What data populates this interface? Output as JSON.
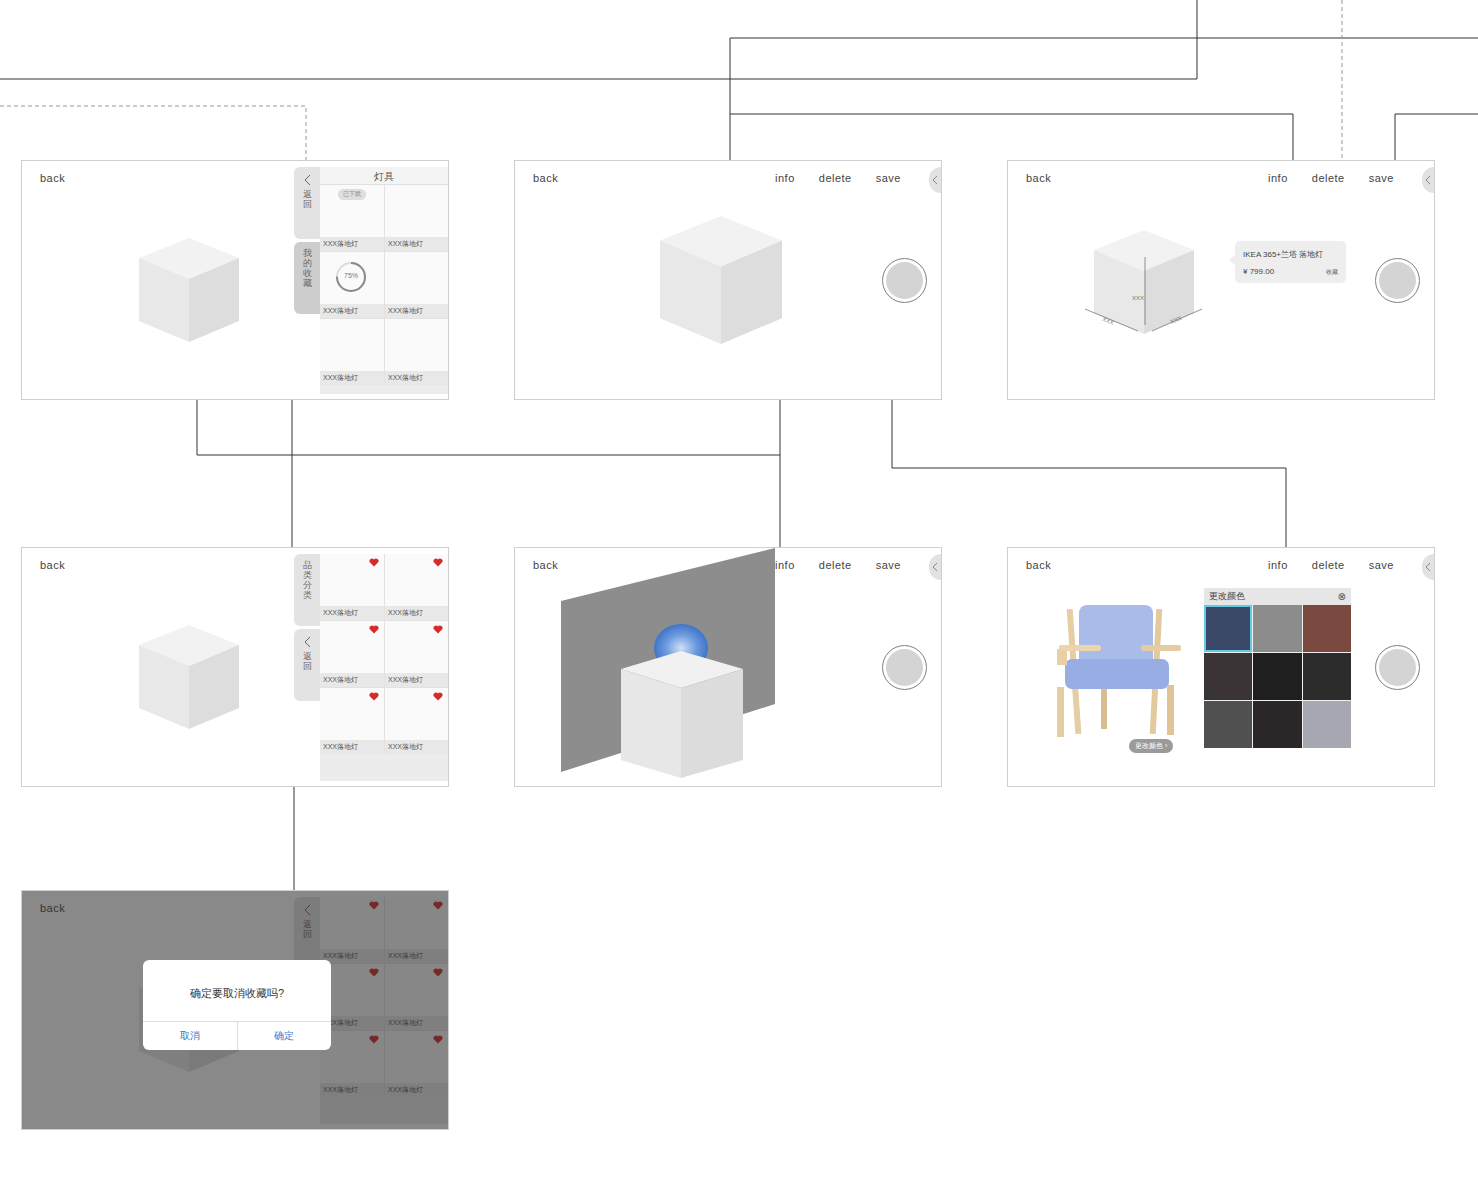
{
  "screens": [
    {
      "kind": "catalog",
      "back": "back",
      "title": "灯具",
      "tabs": [
        {
          "label": "返回",
          "kind": "back",
          "selected": false
        },
        {
          "label": "我的收藏",
          "kind": "plain",
          "selected": true
        }
      ],
      "items": [
        {
          "label": "XXX落地灯",
          "kind": "downloaded",
          "badge": "已下载"
        },
        {
          "label": "XXX落地灯",
          "kind": "plain"
        },
        {
          "label": "XXX落地灯",
          "kind": "downloading",
          "progress": "75%",
          "level": 0.75
        },
        {
          "label": "XXX落地灯",
          "kind": "plain"
        },
        {
          "label": "XXX落地灯",
          "kind": "plain"
        },
        {
          "label": "XXX落地灯",
          "kind": "plain"
        }
      ]
    },
    {
      "kind": "editor",
      "back": "back",
      "actions": [
        "info",
        "delete",
        "save"
      ]
    },
    {
      "kind": "info",
      "back": "back",
      "actions": [
        "info",
        "delete",
        "save"
      ],
      "dimensions": [
        "XXX",
        "XXX",
        "XXX"
      ],
      "tooltip": {
        "name": "IKEA 365+兰塔 落地灯",
        "price": "¥ 799.00",
        "favorite": "收藏"
      }
    },
    {
      "kind": "favorites",
      "back": "back",
      "tabs": [
        {
          "label": "品类分类",
          "kind": "plain",
          "selected": false
        },
        {
          "label": "返回",
          "kind": "back",
          "selected": false
        }
      ],
      "items": [
        {
          "label": "XXX落地灯",
          "favorited": true
        },
        {
          "label": "XXX落地灯",
          "favorited": true
        },
        {
          "label": "XXX落地灯",
          "favorited": true
        },
        {
          "label": "XXX落地灯",
          "favorited": true
        },
        {
          "label": "XXX落地灯",
          "favorited": true
        },
        {
          "label": "XXX落地灯",
          "favorited": true
        }
      ]
    },
    {
      "kind": "wall",
      "back": "back",
      "actions": [
        "info",
        "delete",
        "save"
      ]
    },
    {
      "kind": "color",
      "back": "back",
      "actions": [
        "info",
        "delete",
        "save"
      ],
      "photoButton": "更改颜色 ›",
      "panel": {
        "title": "更改颜色",
        "close": "⊗"
      },
      "swatches": [
        {
          "color": "#3b4868",
          "selected": true
        },
        {
          "color": "#8c8c8c",
          "selected": false
        },
        {
          "color": "#7a4a40",
          "selected": false
        },
        {
          "color": "#3b3437",
          "selected": false
        },
        {
          "color": "#1f1f1f",
          "selected": false
        },
        {
          "color": "#2c2c2c",
          "selected": false
        },
        {
          "color": "#505050",
          "selected": false
        },
        {
          "color": "#2b2627",
          "selected": false
        },
        {
          "color": "#a6a7b0",
          "selected": false
        }
      ]
    },
    {
      "kind": "dialog",
      "back": "back",
      "tabs": [
        {
          "label": "返回",
          "kind": "back",
          "selected": false
        }
      ],
      "items": [
        {
          "label": "XXX落地灯",
          "favorited": true
        },
        {
          "label": "XXX落地灯",
          "favorited": true
        },
        {
          "label": "XXX落地灯",
          "favorited": true
        },
        {
          "label": "XXX落地灯",
          "favorited": true
        },
        {
          "label": "XXX落地灯",
          "favorited": true
        },
        {
          "label": "XXX落地灯",
          "favorited": true
        }
      ],
      "dialog": {
        "message": "确定要取消收藏吗?",
        "buttons": [
          "取消",
          "确定"
        ]
      }
    }
  ]
}
